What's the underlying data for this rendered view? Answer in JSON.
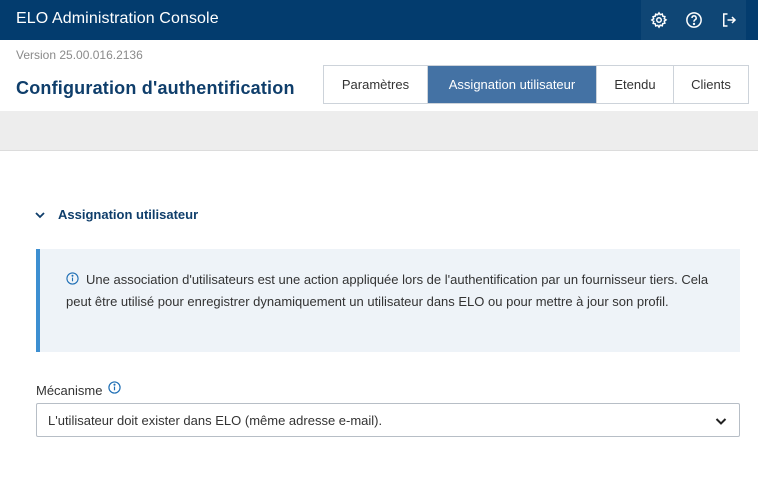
{
  "header": {
    "app_title": "ELO Administration Console",
    "icons": [
      "gear-icon",
      "help-icon",
      "logout-icon"
    ]
  },
  "version": "Version 25.00.016.2136",
  "page_title": "Configuration d'authentification",
  "tabs": [
    {
      "label": "Paramètres",
      "active": false
    },
    {
      "label": "Assignation utilisateur",
      "active": true
    },
    {
      "label": "Etendu",
      "active": false
    },
    {
      "label": "Clients",
      "active": false
    }
  ],
  "section": {
    "title": "Assignation utilisateur",
    "expanded": true,
    "info_text": "Une association d'utilisateurs est une action appliquée lors de l'authentification par un fournisseur tiers. Cela peut être utilisé pour enregistrer dynamiquement un utilisateur dans ELO ou pour mettre à jour son profil."
  },
  "mechanism": {
    "label": "Mécanisme",
    "selected": "L'utilisateur doit exister dans ELO (même adresse e-mail)."
  },
  "colors": {
    "header_bg": "#033c6e",
    "active_tab": "#4472a4",
    "info_border": "#3d8fd1",
    "title_text": "#0f3e6b"
  }
}
